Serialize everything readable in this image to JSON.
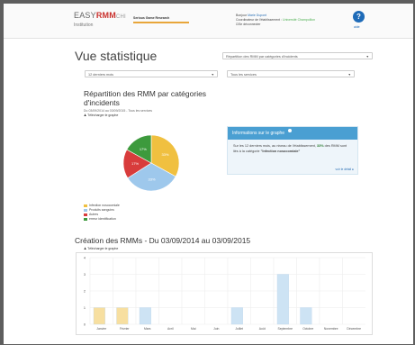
{
  "header": {
    "logo_easy": "EASY",
    "logo_rmm": "RMM",
    "logo_ch": "CHI",
    "logo_sub": "Institution",
    "partner": "Serious Game Research",
    "user_line1_prefix": "Bonjour",
    "user_name": "Marie Dupont",
    "user_line2_prefix": "Coordinateur de l'établissement :",
    "user_establishment": "Université Champollion",
    "logout": "Se déconnecter",
    "help_icon": "question-circle-icon",
    "help_label": "aide"
  },
  "page": {
    "title": "Vue statistique",
    "stat_select": "Répartition des RMM par catégories d'incidents",
    "period_select": "12 derniers mois",
    "services_select": "Tous les services"
  },
  "chart_data": [
    {
      "type": "pie",
      "title": "Répartition des RMM par catégories d'incidents",
      "subtitle": "Du 03/09/2014 au 03/09/2015 - Tous les services",
      "download": "Télécharger le graphe",
      "slices": [
        {
          "label": "Infection nosocomiale",
          "value": 33,
          "color": "#f0c040"
        },
        {
          "label": "Produits sanguins",
          "value": 33,
          "color": "#9ec8ec"
        },
        {
          "label": "Autres",
          "value": 17,
          "color": "#d83c3c"
        },
        {
          "label": "erreur identification",
          "value": 17,
          "color": "#3d9a3d"
        }
      ]
    },
    {
      "type": "bar",
      "title": "Création des RMMs - Du 03/09/2014 au 03/09/2015",
      "download": "Télécharger le graphe",
      "categories": [
        "Janvier",
        "Février",
        "Mars",
        "Avril",
        "Mai",
        "Juin",
        "Juillet",
        "Août",
        "Septembre",
        "Octobre",
        "Novembre",
        "Décembre"
      ],
      "values": [
        1,
        1,
        1,
        0,
        0,
        0,
        1,
        0,
        3,
        1,
        0,
        0
      ],
      "colors": [
        "#f7dfa0",
        "#f7dfa0",
        "#cde3f4",
        "#cde3f4",
        "#cde3f4",
        "#cde3f4",
        "#cde3f4",
        "#cde3f4",
        "#cde3f4",
        "#cde3f4",
        "#cde3f4",
        "#cde3f4"
      ],
      "yticks": [
        0,
        1,
        2,
        3,
        4
      ],
      "ylim": [
        0,
        4
      ]
    }
  ],
  "info": {
    "title": "Informations sur le graphe",
    "text_before": "Sur les 12 derniers mois, au niveau de l'établissement,",
    "percent": "33%",
    "text_middle": "des RMM sont liés à la catégorie",
    "category": "\"Infection nosocomiale\"",
    "more": "voir le détail"
  },
  "colors": {
    "accent": "#4a9fd2",
    "brand_red": "#c9302c",
    "help_blue": "#1e6bb8"
  }
}
